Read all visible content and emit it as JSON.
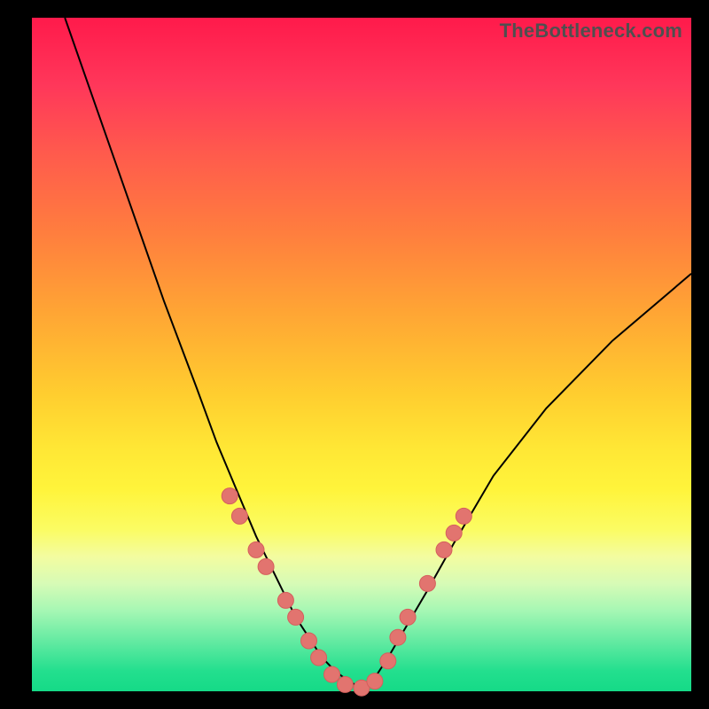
{
  "watermark": "TheBottleneck.com",
  "colors": {
    "dot_fill": "#e2746f",
    "dot_stroke": "#d55f5d",
    "curve": "#000000"
  },
  "chart_data": {
    "type": "line",
    "title": "",
    "xlabel": "",
    "ylabel": "",
    "xlim": [
      0,
      100
    ],
    "ylim": [
      0,
      100
    ],
    "background_gradient": [
      "#ff1a4b",
      "#ffce2f",
      "#fff43b",
      "#15da87"
    ],
    "series": [
      {
        "name": "left-branch",
        "x": [
          5,
          10,
          15,
          20,
          25,
          28,
          31,
          34,
          37,
          40,
          42,
          44,
          46,
          48,
          50
        ],
        "y": [
          100,
          86,
          72,
          58,
          45,
          37,
          30,
          23,
          17,
          11,
          8,
          5,
          3,
          1.5,
          0.5
        ]
      },
      {
        "name": "right-branch",
        "x": [
          50,
          52,
          54,
          57,
          60,
          64,
          70,
          78,
          88,
          100
        ],
        "y": [
          0.5,
          2,
          5,
          10,
          15,
          22,
          32,
          42,
          52,
          62
        ]
      }
    ],
    "points": [
      {
        "x": 30,
        "y": 29
      },
      {
        "x": 31.5,
        "y": 26
      },
      {
        "x": 34,
        "y": 21
      },
      {
        "x": 35.5,
        "y": 18.5
      },
      {
        "x": 38.5,
        "y": 13.5
      },
      {
        "x": 40,
        "y": 11
      },
      {
        "x": 42,
        "y": 7.5
      },
      {
        "x": 43.5,
        "y": 5
      },
      {
        "x": 45.5,
        "y": 2.5
      },
      {
        "x": 47.5,
        "y": 1
      },
      {
        "x": 50,
        "y": 0.5
      },
      {
        "x": 52,
        "y": 1.5
      },
      {
        "x": 54,
        "y": 4.5
      },
      {
        "x": 55.5,
        "y": 8
      },
      {
        "x": 57,
        "y": 11
      },
      {
        "x": 60,
        "y": 16
      },
      {
        "x": 62.5,
        "y": 21
      },
      {
        "x": 64,
        "y": 23.5
      },
      {
        "x": 65.5,
        "y": 26
      }
    ],
    "dot_radius_px": 9
  }
}
